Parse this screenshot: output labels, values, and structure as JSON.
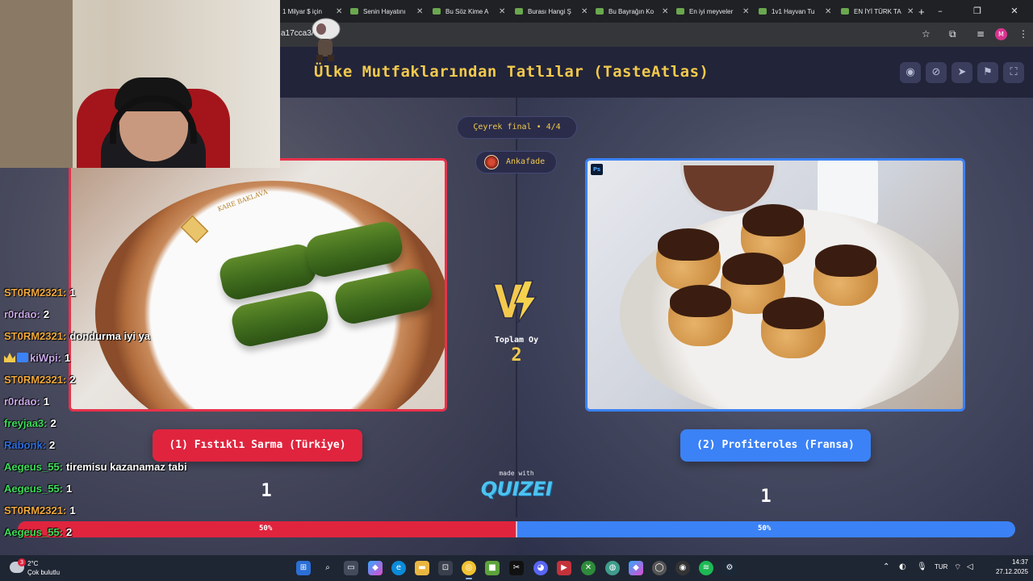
{
  "browser": {
    "tabs": [
      {
        "label": "1 Milyar $ için"
      },
      {
        "label": "Senin Hayatını"
      },
      {
        "label": "Bu Söz Kime A"
      },
      {
        "label": "Burası Hangi Ş"
      },
      {
        "label": "Bu Bayrağın Ko"
      },
      {
        "label": "En iyi meyveler"
      },
      {
        "label": "1v1 Hayvan Tu"
      },
      {
        "label": "EN İYİ TÜRK TA"
      }
    ],
    "close_glyph": "✕",
    "new_tab_glyph": "+",
    "url": "a17cca3/",
    "profile_initial": "M",
    "window_controls": {
      "minimize": "–",
      "restore": "❐",
      "close": "✕"
    }
  },
  "quiz": {
    "title": "Ülke Mutfaklarından Tatlılar (TasteAtlas)",
    "round": "Çeyrek final • 4/4",
    "author": "Ankafade",
    "total_label": "Toplam Oy",
    "total_votes": "2",
    "left": {
      "label": "(1) Fıstıklı Sarma (Türkiye)",
      "votes": "1",
      "percent_label": "50%",
      "percent": 50
    },
    "right": {
      "label": "(2) Profiteroles (Fransa)",
      "votes": "1",
      "percent_label": "50%",
      "percent": 50
    },
    "made_with": "made with",
    "brand": "QUIZEI",
    "plate_text": "KARE BAKLAVA",
    "ps_badge": "Ps",
    "colors": {
      "left": "#e0243e",
      "right": "#3b82f6",
      "accent": "#f2c94c"
    }
  },
  "chat": [
    {
      "user": "ST0RM2321",
      "color": "#f2a93b",
      "msg": "1"
    },
    {
      "user": "r0rdao",
      "color": "#c9a7e8",
      "msg": "2"
    },
    {
      "user": "ST0RM2321",
      "color": "#f2a93b",
      "msg": "dondurma iyi ya"
    },
    {
      "user": "kiWpi",
      "color": "#c9a7e8",
      "msg": "1",
      "badges": true
    },
    {
      "user": "ST0RM2321",
      "color": "#f2a93b",
      "msg": "2"
    },
    {
      "user": "r0rdao",
      "color": "#c9a7e8",
      "msg": "1"
    },
    {
      "user": "freyjaa3",
      "color": "#3ddc5a",
      "msg": "2"
    },
    {
      "user": "Rabonk",
      "color": "#2f6fe0",
      "msg": "2"
    },
    {
      "user": "Aegeus_55",
      "color": "#3ddc5a",
      "msg": "tiremisu kazanamaz tabi"
    },
    {
      "user": "Aegeus_55",
      "color": "#3ddc5a",
      "msg": "1"
    },
    {
      "user": "ST0RM2321",
      "color": "#f2a93b",
      "msg": "1"
    },
    {
      "user": "Aegeus_55",
      "color": "#3ddc5a",
      "msg": "2"
    }
  ],
  "taskbar": {
    "weather_temp": "2°C",
    "weather_desc": "Çok bulutlu",
    "weather_badge": "3",
    "language": "TUR",
    "time": "14:37",
    "date": "27.12.2025"
  }
}
